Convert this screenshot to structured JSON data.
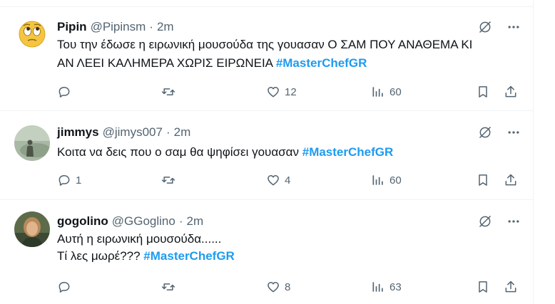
{
  "tweets": [
    {
      "name": "Pipin",
      "handle": "@Pipinsm",
      "separator": "·",
      "time": "2m",
      "lines": [
        "Του την έδωσε η ειρωνική μουσούδα της γουασαν Ο ΣΑΜ ΠΟΥ ΑΝΑΘΕΜΑ ΚΙ",
        "ΑΝ ΛΕΕΙ ΚΑΛΗΜΕΡΑ ΧΩΡΙΣ ΕΙΡΩΝΕΙΑ "
      ],
      "hashtag": "#MasterChefGR",
      "replies": "",
      "retweets": "",
      "likes": "12",
      "views": "60",
      "avatar": "rolling-eyes-emoji"
    },
    {
      "name": "jimmys",
      "handle": "@jimys007",
      "separator": "·",
      "time": "2m",
      "lines": [
        "Κοιτα να δεις που ο σαμ θα ψηφίσει γουασαν "
      ],
      "hashtag": "#MasterChefGR",
      "replies": "1",
      "retweets": "",
      "likes": "4",
      "views": "60",
      "avatar": "silhouette-photo"
    },
    {
      "name": "gogolino",
      "handle": "@GGoglino",
      "separator": "·",
      "time": "2m",
      "lines": [
        "Αυτή η ειρωνική μουσούδα......",
        "Τί λες μωρέ??? "
      ],
      "hashtag": "#MasterChefGR",
      "replies": "",
      "retweets": "",
      "likes": "8",
      "views": "63",
      "avatar": "person-photo"
    }
  ],
  "icons": {
    "reply": "reply-icon",
    "retweet": "retweet-icon",
    "like": "like-icon",
    "views": "views-icon",
    "bookmark": "bookmark-icon",
    "share": "share-icon",
    "grok": "grok-icon",
    "more": "more-icon"
  },
  "colors": {
    "accent": "#1d9bf0",
    "muted": "#536471",
    "text": "#0f1419",
    "border": "#eff3f4"
  }
}
